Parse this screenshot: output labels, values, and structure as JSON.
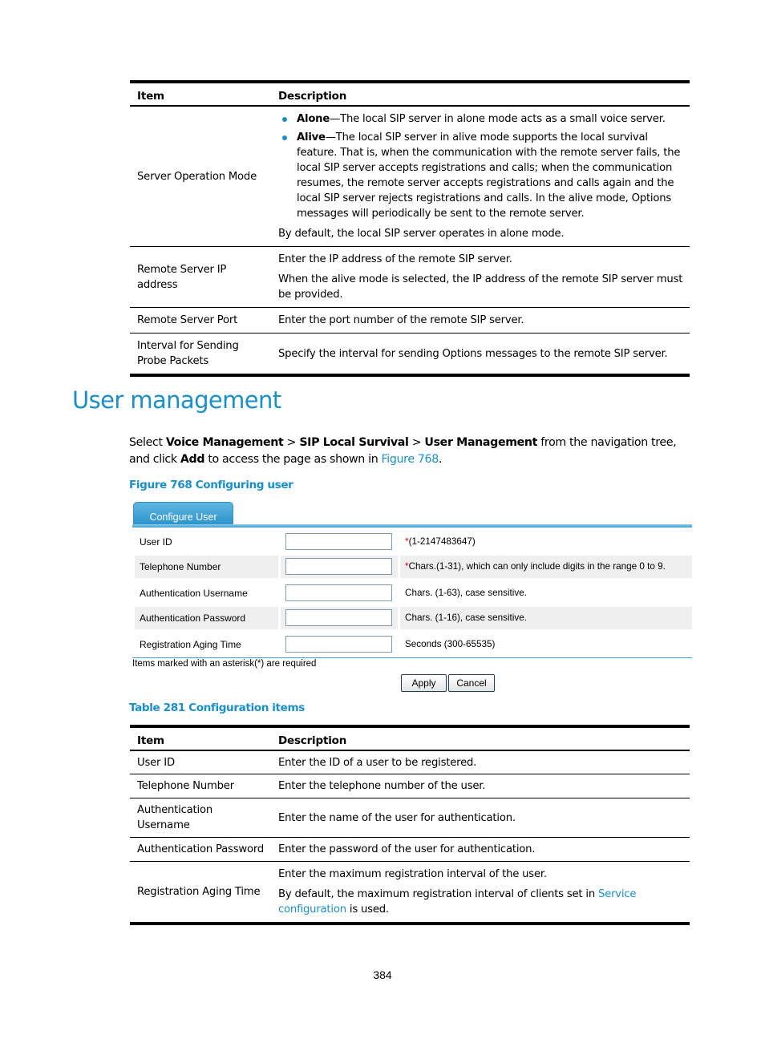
{
  "table_top": {
    "headers": [
      "Item",
      "Description"
    ],
    "rows": [
      {
        "item": "Server Operation Mode",
        "bullets": [
          {
            "term": "Alone",
            "text": "—The local SIP server in alone mode acts as a small voice server."
          },
          {
            "term": "Alive",
            "text": "—The local SIP server in alive mode supports the local survival feature. That is, when the communication with the remote server fails, the local SIP server accepts registrations and calls; when the communication resumes, the remote server accepts registrations and calls again and the local SIP server rejects registrations and calls. In the alive mode, Options messages will periodically be sent to the remote server."
          }
        ],
        "paragraphs": [
          "By default, the local SIP server operates in alone mode."
        ]
      },
      {
        "item": "Remote Server IP address",
        "paragraphs": [
          "Enter the IP address of the remote SIP server.",
          "When the alive mode is selected, the IP address of the remote SIP server must be provided."
        ]
      },
      {
        "item": "Remote Server Port",
        "paragraphs": [
          "Enter the port number of the remote SIP server."
        ]
      },
      {
        "item": "Interval for Sending Probe Packets",
        "paragraphs": [
          "Specify the interval for sending Options messages to the remote SIP server."
        ]
      }
    ]
  },
  "section": {
    "title": "User management",
    "intro": {
      "select": "Select ",
      "path1": "Voice Management",
      "sep": " > ",
      "path2": "SIP Local Survival",
      "path3": "User Management",
      "mid": " from the navigation tree, and click ",
      "add": "Add",
      "tail": " to access the page as shown in ",
      "figure_link": "Figure 768",
      "end": "."
    },
    "figure_caption": "Figure 768 Configuring user"
  },
  "form": {
    "tab_label": "Configure User",
    "fields": [
      {
        "label": "User ID",
        "value": "",
        "required": true,
        "hint": "(1-2147483647)"
      },
      {
        "label": "Telephone Number",
        "value": "",
        "required": true,
        "hint": "Chars.(1-31), which can only include digits in the range 0 to 9."
      },
      {
        "label": "Authentication Username",
        "value": "",
        "required": false,
        "hint": "Chars. (1-63), case sensitive."
      },
      {
        "label": "Authentication Password",
        "value": "",
        "required": false,
        "hint": "Chars. (1-16), case sensitive."
      },
      {
        "label": "Registration Aging Time",
        "value": "",
        "required": false,
        "hint": "Seconds (300-65535)"
      }
    ],
    "required_mark": "*",
    "note": "Items marked with an asterisk(*) are required",
    "apply_label": "Apply",
    "cancel_label": "Cancel"
  },
  "table_caption": "Table 281 Configuration items",
  "table_bottom": {
    "headers": [
      "Item",
      "Description"
    ],
    "rows": [
      {
        "item": "User ID",
        "paragraphs": [
          "Enter the ID of a user to be registered."
        ]
      },
      {
        "item": "Telephone Number",
        "paragraphs": [
          "Enter the telephone number of the user."
        ]
      },
      {
        "item": "Authentication Username",
        "paragraphs": [
          "Enter the name of the user for authentication."
        ]
      },
      {
        "item": "Authentication Password",
        "paragraphs": [
          "Enter the password of the user for authentication."
        ]
      },
      {
        "item": "Registration Aging Time",
        "paragraphs": [
          "Enter the maximum registration interval of the user."
        ],
        "last_pre": "By default, the maximum registration interval of clients set in ",
        "last_link": "Service configuration",
        "last_post": " is used."
      }
    ]
  },
  "page_number": "384",
  "colors": {
    "accent": "#1a8fc9",
    "required": "#e00000",
    "tab": "#2b93cc"
  }
}
